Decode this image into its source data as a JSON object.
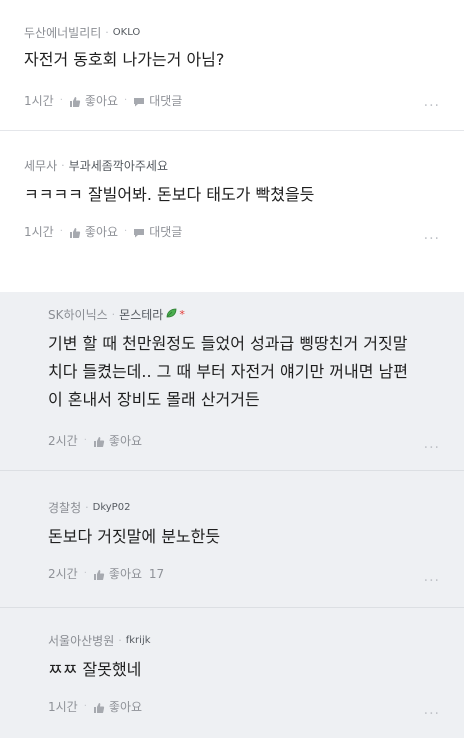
{
  "comments": [
    {
      "company": "두산에너빌리티",
      "nickname": "OKLO",
      "text": "자전거 동호회 나가는거 아님?",
      "time": "1시간",
      "like": "좋아요",
      "reply": "대댓글"
    },
    {
      "company": "세무사",
      "nickname": "부과세좀깍아주세요",
      "text": "ㅋㅋㅋㅋ 잘빌어봐. 돈보다 태도가 빡쳤을듯",
      "time": "1시간",
      "like": "좋아요",
      "reply": "대댓글"
    }
  ],
  "replies": [
    {
      "company": "SK하이닉스",
      "nickname": "몬스테라",
      "text_lines": [
        "기변 할 때 천만원정도 들었어 성과급 삥땅친거 거짓말",
        "치다 들켰는데.. 그 때 부터 자전거 얘기만 꺼내면 남편",
        "이 혼내서 장비도 몰래 산거거든"
      ],
      "time": "2시간",
      "like": "좋아요"
    },
    {
      "company": "경찰청",
      "nickname": "DkyP02",
      "text": "돈보다 거짓말에 분노한듯",
      "time": "2시간",
      "like": "좋아요",
      "like_count": "17"
    },
    {
      "company": "서울아산병원",
      "nickname": "fkrijk",
      "text": "ㅉㅉ 잘못했네",
      "time": "1시간",
      "like": "좋아요"
    }
  ],
  "more_glyph": "...",
  "colors": {
    "reply_bg": "#eef0f3",
    "leaf": "#4caf50",
    "star": "#e53935"
  }
}
